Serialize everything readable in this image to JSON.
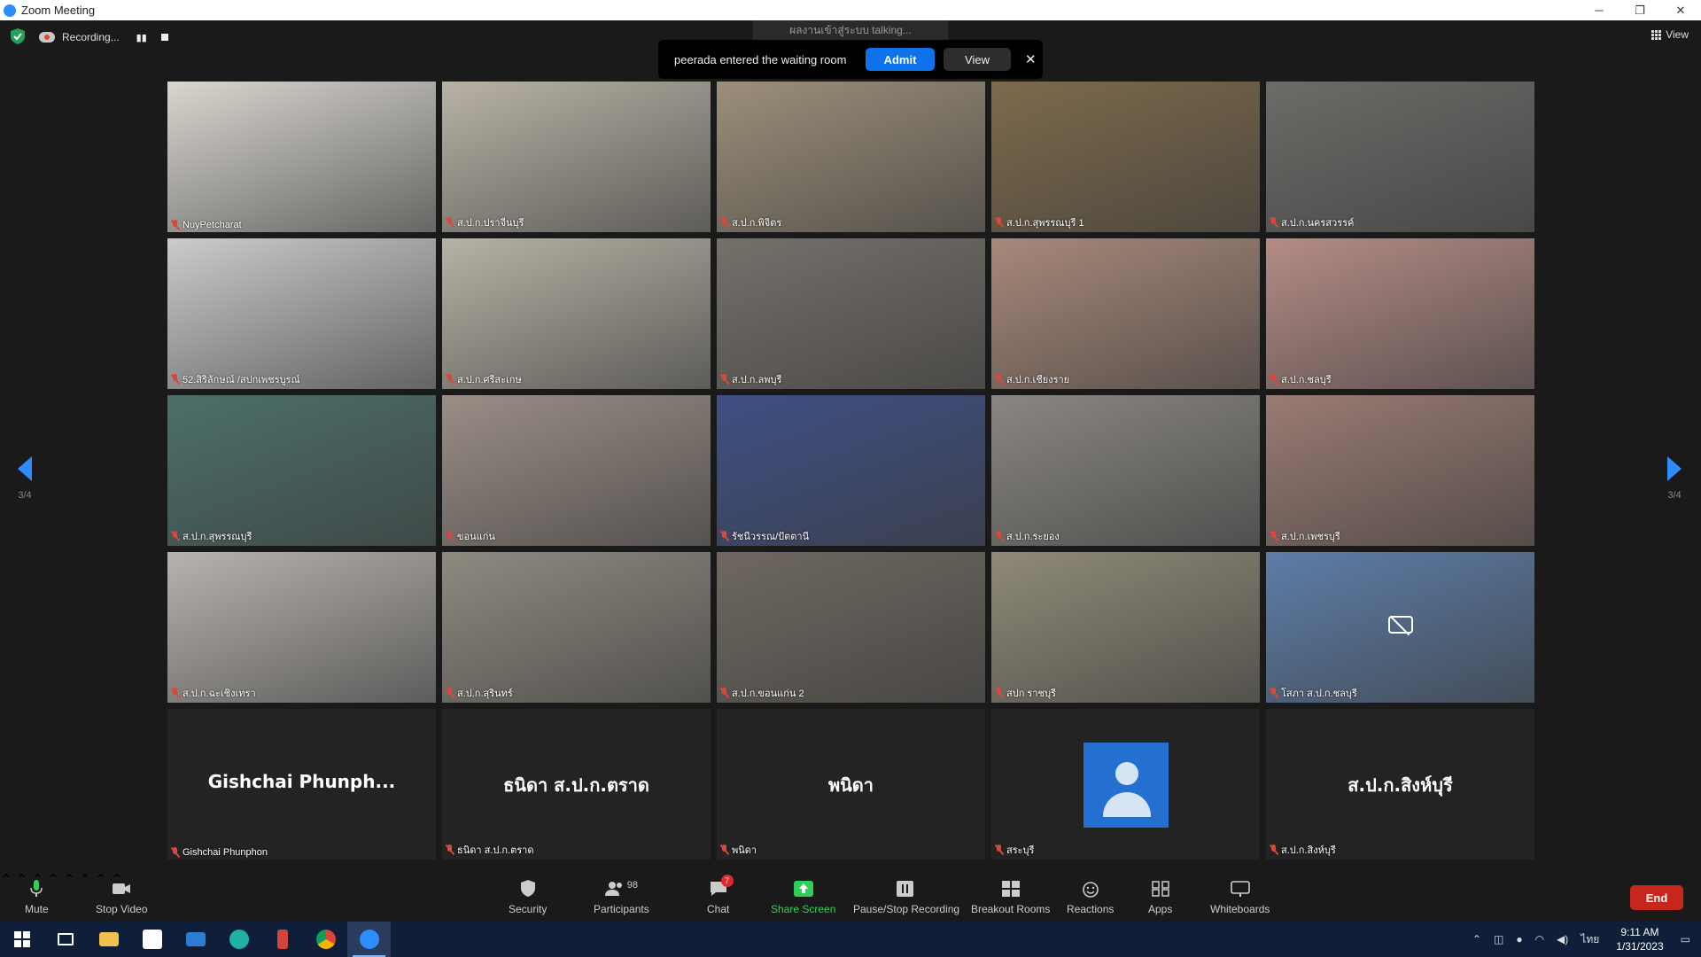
{
  "window": {
    "title": "Zoom Meeting",
    "minimize": "─",
    "restore": "❐",
    "close": "✕"
  },
  "topbar": {
    "recording_label": "Recording...",
    "talking_text": "ผลงานเข้าสู่ระบบ talking...",
    "view_label": "View"
  },
  "waiting_room": {
    "message": "peerada entered the waiting room",
    "admit_label": "Admit",
    "view_label": "View",
    "close_glyph": "✕"
  },
  "pagination": {
    "left_label": "3/4",
    "right_label": "3/4"
  },
  "tiles": [
    {
      "name": "NuyPetcharat",
      "color": "#d9d6cf",
      "type": "video"
    },
    {
      "name": "ส.ป.ก.ปราจีนบุรี",
      "color": "#b9b3a6",
      "type": "video"
    },
    {
      "name": "ส.ป.ก.พิจิตร",
      "color": "#9c8f7a",
      "type": "video"
    },
    {
      "name": "ส.ป.ก.สุพรรณบุรี 1",
      "color": "#7d6a4b",
      "type": "video"
    },
    {
      "name": "ส.ป.ก.นครสวรรค์",
      "color": "#6b6b68",
      "type": "video"
    },
    {
      "name": "52.สิริลักษณ์ /สปกเพชรบูรณ์",
      "color": "#c9cbcd",
      "type": "video"
    },
    {
      "name": "ส.ป.ก.ศรีสะเกษ",
      "color": "#b7b2a5",
      "type": "video"
    },
    {
      "name": "ส.ป.ก.ลพบุรี",
      "color": "#75706a",
      "type": "video"
    },
    {
      "name": "ส.ป.ก.เชียงราย",
      "color": "#a8897a",
      "type": "video"
    },
    {
      "name": "ส.ป.ก.ชลบุรี",
      "color": "#b58c86",
      "type": "video"
    },
    {
      "name": "ส.ป.ก.สุพรรณบุรี",
      "color": "#4c6f6a",
      "type": "video"
    },
    {
      "name": "ขอนแก่น",
      "color": "#9a8e86",
      "type": "video"
    },
    {
      "name": "รัชนีวรรณ/ปัตตานี",
      "color": "#3e4f84",
      "type": "video"
    },
    {
      "name": "ส.ป.ก.ระยอง",
      "color": "#8a8782",
      "type": "video"
    },
    {
      "name": "ส.ป.ก.เพชรบุรี",
      "color": "#9a7b73",
      "type": "video"
    },
    {
      "name": "ส.ป.ก.ฉะเชิงเทรา",
      "color": "#b7b3ae",
      "type": "video"
    },
    {
      "name": "ส.ป.ก.สุรินทร์",
      "color": "#8f8a80",
      "type": "video"
    },
    {
      "name": "ส.ป.ก.ขอนแก่น 2",
      "color": "#6e6860",
      "type": "video"
    },
    {
      "name": "สปก ราชบุรี",
      "color": "#8f8a78",
      "type": "video"
    },
    {
      "name": "โสภา ส.ป.ก.ชลบุรี",
      "color": "#5d7da8",
      "type": "video-camoff"
    },
    {
      "name": "Gishchai Phunphon",
      "big": "Gishchai  Phunph...",
      "type": "text"
    },
    {
      "name": "ธนิดา ส.ป.ก.ตราด",
      "big": "ธนิดา ส.ป.ก.ตราด",
      "type": "text"
    },
    {
      "name": "พนิดา",
      "big": "พนิดา",
      "type": "text"
    },
    {
      "name": "สระบุรี",
      "type": "avatar"
    },
    {
      "name": "ส.ป.ก.สิงห์บุรี",
      "big": "ส.ป.ก.สิงห์บุรี",
      "type": "text"
    }
  ],
  "toolbar": {
    "mute": "Mute",
    "stop_video": "Stop Video",
    "security": "Security",
    "participants": "Participants",
    "participants_count": "98",
    "chat": "Chat",
    "chat_badge": "7",
    "share_screen": "Share Screen",
    "pause_stop_recording": "Pause/Stop Recording",
    "breakout_rooms": "Breakout Rooms",
    "reactions": "Reactions",
    "apps": "Apps",
    "whiteboards": "Whiteboards",
    "end": "End",
    "colors": {
      "share_green": "#2fcf5a",
      "end_red": "#c8261d",
      "admit_blue": "#0e72ed"
    }
  },
  "taskbar": {
    "lang": "ไทย",
    "time": "9:11 AM",
    "date": "1/31/2023",
    "icons": [
      "windows-start-icon",
      "task-view-icon",
      "file-explorer-icon",
      "store-icon",
      "mail-icon",
      "edge-icon",
      "app-icon",
      "chrome-icon",
      "zoom-icon"
    ]
  }
}
